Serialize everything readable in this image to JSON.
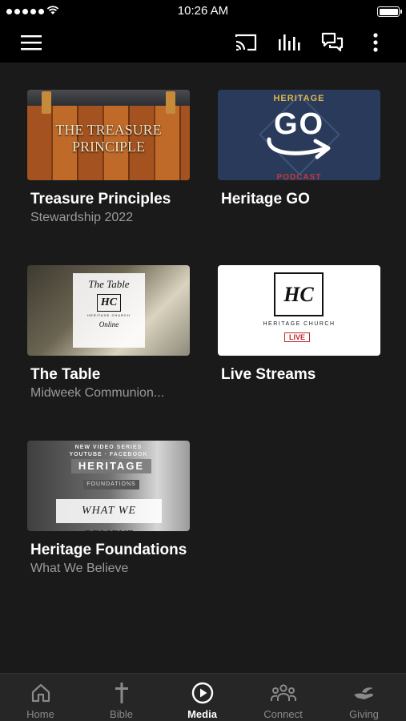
{
  "status_bar": {
    "time": "10:26 AM"
  },
  "app_bar": {
    "icons": [
      "menu-icon",
      "cast-icon",
      "audio-bars-icon",
      "chat-icon",
      "more-vertical-icon"
    ]
  },
  "media": [
    {
      "title": "Treasure Principles",
      "subtitle": "Stewardship 2022",
      "thumb": {
        "text": "THE TREASURE PRINCIPLE"
      }
    },
    {
      "title": "Heritage GO",
      "subtitle": "",
      "thumb": {
        "top": "HERITAGE",
        "main": "GO",
        "bottom": "PODCAST"
      }
    },
    {
      "title": "The Table",
      "subtitle": "Midweek Communion...",
      "thumb": {
        "line1": "The Table",
        "mark": "HC",
        "line2": "HERITAGE CHURCH",
        "line3": "Online"
      }
    },
    {
      "title": "Live Streams",
      "subtitle": "",
      "thumb": {
        "mark": "HC",
        "name": "HERITAGE CHURCH",
        "badge": "LIVE"
      }
    },
    {
      "title": "Heritage Foundations",
      "subtitle": "What We Believe",
      "thumb": {
        "top1": "NEW VIDEO SERIES",
        "top2": "YOUTUBE · FACEBOOK",
        "heading": "HERITAGE",
        "sub": "FOUNDATIONS",
        "tagline": "WHAT WE BELIEVE"
      }
    }
  ],
  "tabs": [
    {
      "label": "Home",
      "icon": "home-icon"
    },
    {
      "label": "Bible",
      "icon": "cross-icon"
    },
    {
      "label": "Media",
      "icon": "play-circle-icon",
      "active": true
    },
    {
      "label": "Connect",
      "icon": "group-icon"
    },
    {
      "label": "Giving",
      "icon": "giving-hand-icon"
    }
  ],
  "colors": {
    "background": "#1a1a1a",
    "bar": "#000000",
    "tabbar": "#262626",
    "subtitle": "#9a9a9a"
  }
}
